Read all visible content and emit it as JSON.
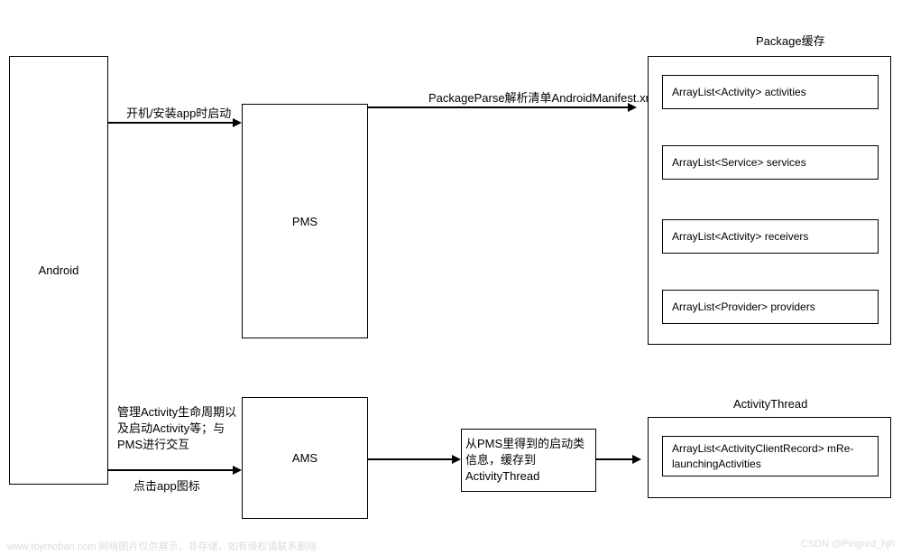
{
  "nodes": {
    "android": "Android",
    "pms": "PMS",
    "ams": "AMS",
    "package_cache_title": "Package缓存",
    "activity_thread_title": "ActivityThread",
    "cache_items": {
      "activities": "ArrayList<Activity> activities",
      "services": "ArrayList<Service> services",
      "receivers": "ArrayList<Activity> receivers",
      "providers": "ArrayList<Provider> providers"
    },
    "ams_middle": "从PMS里得到的启动类信息，缓存到ActivityThread",
    "activity_thread_item": "ArrayList<ActivityClientRecord> mRe-launchingActivities"
  },
  "labels": {
    "to_pms": "开机/安装app时启动",
    "pms_to_cache": "PackageParse解析清单AndroidManifest.xml",
    "to_ams_1": "管理Activity生命周期以及启动Activity等；与PMS进行交互",
    "to_ams_2": "点击app图标"
  },
  "watermarks": {
    "left": "www.toymoban.com 网络图片仅供展示，非存储，如有侵权请联系删除",
    "right": "CSDN @Pingred_hjh"
  }
}
